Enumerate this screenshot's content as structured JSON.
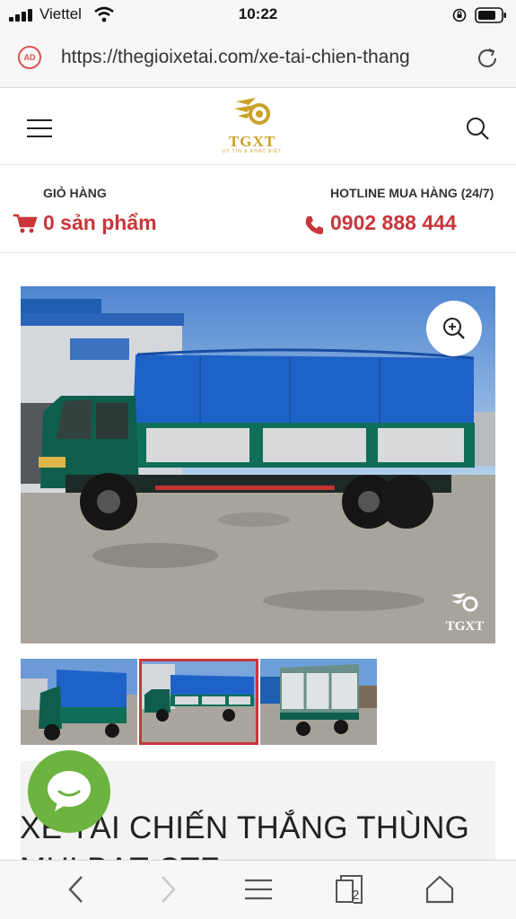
{
  "status_bar": {
    "carrier": "Viettel",
    "time": "10:22"
  },
  "browser": {
    "url": "https://thegioixetai.com/xe-tai-chien-thang",
    "ad_badge": "AD",
    "tab_count": "2"
  },
  "header": {
    "logo_text": "TGXT",
    "logo_tagline": "UY TÍN & KHÁC BIỆT"
  },
  "cart": {
    "label": "GIỎ HÀNG",
    "value": "0 sản phẩm"
  },
  "hotline": {
    "label": "HOTLINE MUA HÀNG (24/7)",
    "number": "0902 888 444"
  },
  "product": {
    "image_watermark": "TGXT",
    "title": "XE TẢI CHIẾN THẮNG THÙNG MUI BẠT CTF"
  },
  "colors": {
    "accent_red": "#c8363a",
    "brand_gold": "#c9a227",
    "chat_green": "#6db33f"
  },
  "icons": [
    "signal-icon",
    "wifi-icon",
    "lock-rotation-icon",
    "battery-icon",
    "ad-block-icon",
    "reload-icon",
    "menu-icon",
    "search-icon",
    "cart-icon",
    "phone-icon",
    "zoom-icon",
    "chat-icon",
    "back-icon",
    "forward-icon",
    "menu-icon",
    "tabs-icon",
    "home-icon"
  ]
}
